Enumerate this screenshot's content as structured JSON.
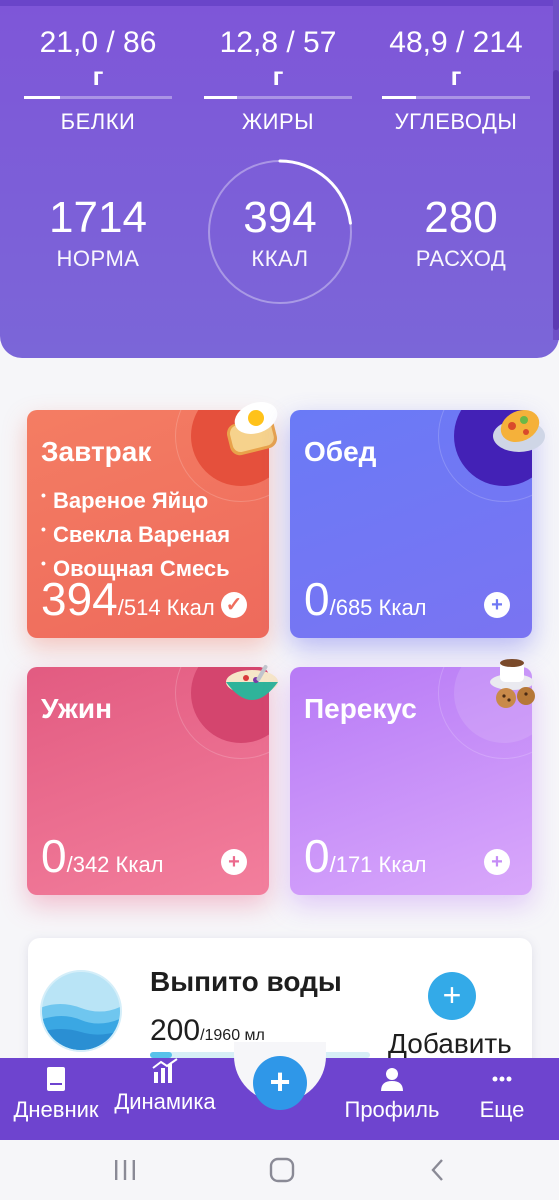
{
  "macros": [
    {
      "value": "21,0 / 86",
      "unit": "г",
      "label": "БЕЛКИ",
      "progress": 0.24
    },
    {
      "value": "12,8 / 57",
      "unit": "г",
      "label": "ЖИРЫ",
      "progress": 0.22
    },
    {
      "value": "48,9 / 214",
      "unit": "г",
      "label": "УГЛЕВОДЫ",
      "progress": 0.23
    }
  ],
  "summary": {
    "norm_value": "1714",
    "norm_label": "НОРМА",
    "eaten_value": "394",
    "eaten_label": "ККАЛ",
    "eaten_progress": 0.23,
    "burn_value": "280",
    "burn_label": "РАСХОД"
  },
  "meals": [
    {
      "title": "Завтрак",
      "items": [
        "Вареное Яйцо",
        "Свекла Вареная",
        "Овощная Смесь"
      ],
      "kcal": "394",
      "kcal_goal": "/514 Ккал",
      "action": "✓"
    },
    {
      "title": "Обед",
      "items": [],
      "kcal": "0",
      "kcal_goal": "/685 Ккал",
      "action": "+"
    },
    {
      "title": "Ужин",
      "items": [],
      "kcal": "0",
      "kcal_goal": "/342 Ккал",
      "action": "+"
    },
    {
      "title": "Перекус",
      "items": [],
      "kcal": "0",
      "kcal_goal": "/171 Ккал",
      "action": "+"
    }
  ],
  "water": {
    "title": "Выпито воды",
    "amount": "200",
    "goal": "/1960 мл",
    "progress": 0.1,
    "add_icon": "+",
    "add_label": "Добавить"
  },
  "nav": {
    "diary": "Дневник",
    "dynamics": "Динамика",
    "add_icon": "+",
    "profile": "Профиль",
    "more": "Еще"
  },
  "colors": {
    "header": "#7e56d8",
    "breakfast": "#f07060",
    "lunch": "#6f78f4",
    "dinner": "#ec6a8e",
    "snack": "#c58cf6",
    "accent": "#2f97e8"
  },
  "icons": [
    "egg-toast-icon",
    "omelette-plate-icon",
    "porridge-bowl-icon",
    "coffee-cookies-icon",
    "book-icon",
    "chart-icon",
    "person-icon",
    "more-icon",
    "water-ball-icon"
  ]
}
